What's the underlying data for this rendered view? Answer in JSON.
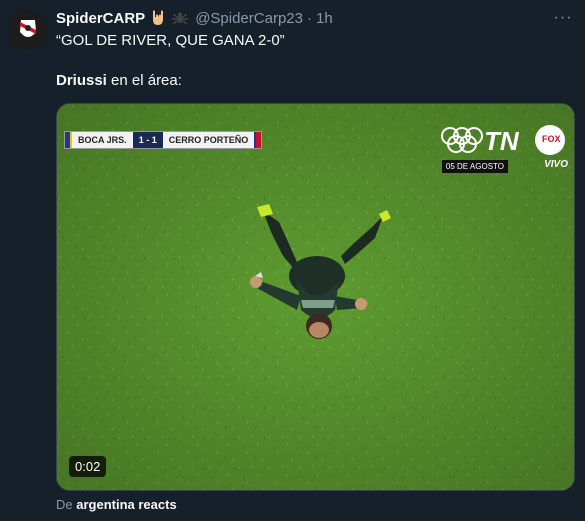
{
  "tweet": {
    "display_name": "SpiderCARP",
    "handle": "@SpiderCarp23",
    "separator": "·",
    "time": "1h",
    "more_label": "···",
    "line1": "“GOL DE RIVER, QUE GANA 2-0”",
    "line2_bold": "Driussi",
    "line2_rest": " en el área:"
  },
  "media": {
    "home_team": "BOCA JRS.",
    "score": "1 - 1",
    "away_team": "CERRO PORTEÑO",
    "date": "05 DE AGOSTO",
    "live": "VIVO",
    "duration": "0:02"
  },
  "footer": {
    "prefix": "De",
    "source": "argentina reacts"
  },
  "colors": {
    "background": "#15202b",
    "text": "#f7f9f9",
    "muted": "#8b98a5",
    "pitch": "#5c9b2e"
  },
  "icons": [
    "rock-hand-emoji-icon",
    "spider-emoji-icon",
    "more-icon"
  ]
}
